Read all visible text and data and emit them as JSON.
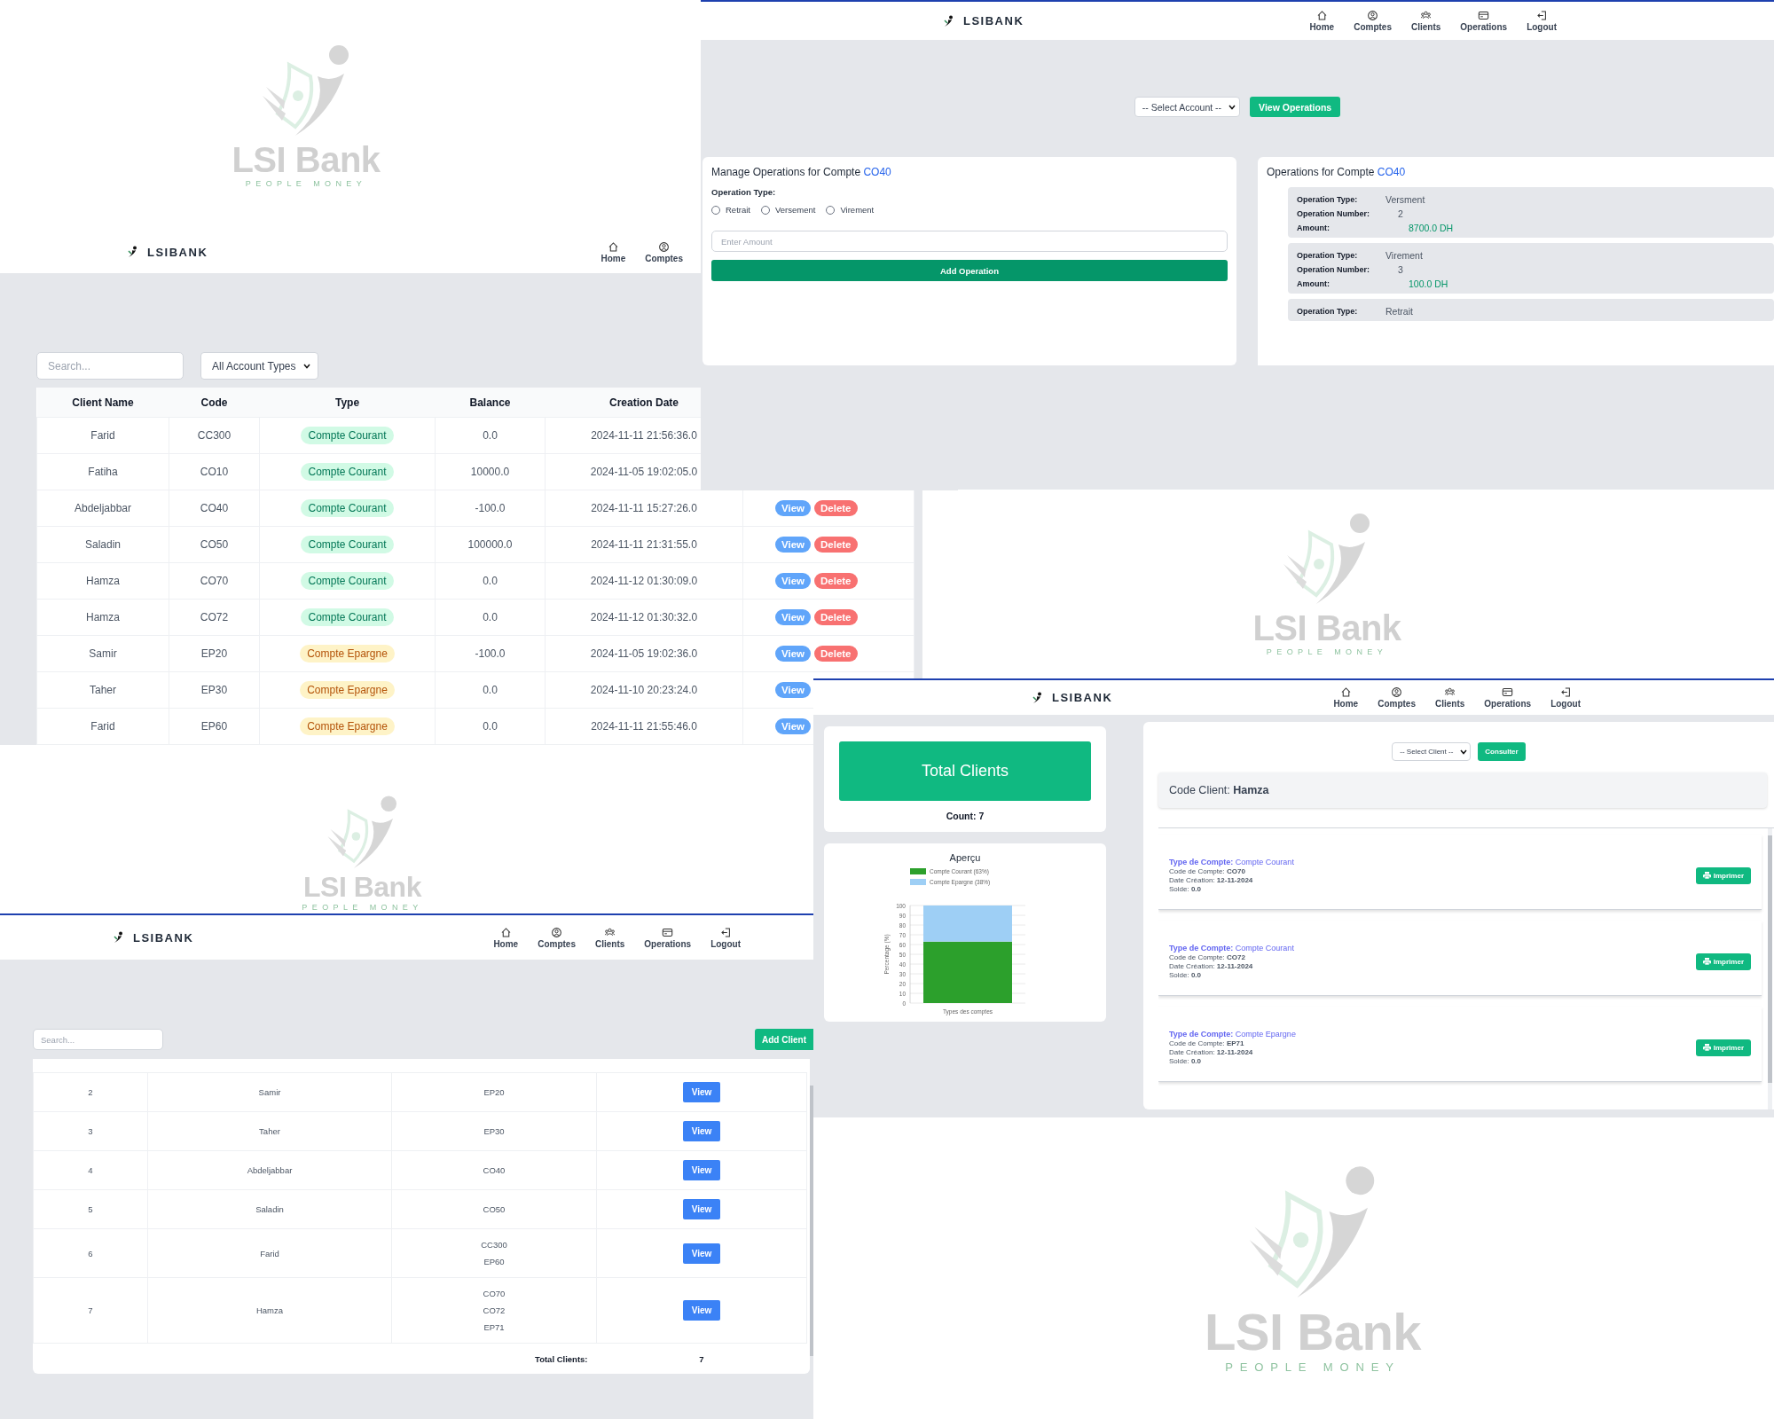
{
  "windows": [
    {
      "kind": "accounts",
      "navbar": {
        "brand": "LSIBANK",
        "items": [
          {
            "label": "Home"
          },
          {
            "label": "Comptes"
          }
        ]
      },
      "search": {
        "placeholder": "Search..."
      },
      "filter": {
        "value": "All Account Types"
      },
      "table": {
        "columns": [
          "Client Name",
          "Code",
          "Type",
          "Balance",
          "Creation Date"
        ],
        "rows": [
          {
            "client_name": "Farid",
            "code": "CC300",
            "type": {
              "label": "Compte Courant",
              "kind": "courant"
            },
            "balance": "0.0",
            "creation_date": "2024-11-11 21:56:36.0",
            "actions": []
          },
          {
            "client_name": "Fatiha",
            "code": "CO10",
            "type": {
              "label": "Compte Courant",
              "kind": "courant"
            },
            "balance": "10000.0",
            "creation_date": "2024-11-05 19:02:05.0",
            "actions": []
          },
          {
            "client_name": "Abdeljabbar",
            "code": "CO40",
            "type": {
              "label": "Compte Courant",
              "kind": "courant"
            },
            "balance": "-100.0",
            "creation_date": "2024-11-11 15:27:26.0",
            "actions": [
              {
                "kind": "view",
                "label": "View"
              },
              {
                "kind": "delete",
                "label": "Delete"
              }
            ]
          },
          {
            "client_name": "Saladin",
            "code": "CO50",
            "type": {
              "label": "Compte Courant",
              "kind": "courant"
            },
            "balance": "100000.0",
            "creation_date": "2024-11-11 21:31:55.0",
            "actions": [
              {
                "kind": "view",
                "label": "View"
              },
              {
                "kind": "delete",
                "label": "Delete"
              }
            ]
          },
          {
            "client_name": "Hamza",
            "code": "CO70",
            "type": {
              "label": "Compte Courant",
              "kind": "courant"
            },
            "balance": "0.0",
            "creation_date": "2024-11-12 01:30:09.0",
            "actions": [
              {
                "kind": "view",
                "label": "View"
              },
              {
                "kind": "delete",
                "label": "Delete"
              }
            ]
          },
          {
            "client_name": "Hamza",
            "code": "CO72",
            "type": {
              "label": "Compte Courant",
              "kind": "courant"
            },
            "balance": "0.0",
            "creation_date": "2024-11-12 01:30:32.0",
            "actions": [
              {
                "kind": "view",
                "label": "View"
              },
              {
                "kind": "delete",
                "label": "Delete"
              }
            ]
          },
          {
            "client_name": "Samir",
            "code": "EP20",
            "type": {
              "label": "Compte Epargne",
              "kind": "epargne"
            },
            "balance": "-100.0",
            "creation_date": "2024-11-05 19:02:36.0",
            "actions": [
              {
                "kind": "view",
                "label": "View"
              },
              {
                "kind": "delete",
                "label": "Delete"
              }
            ]
          },
          {
            "client_name": "Taher",
            "code": "EP30",
            "type": {
              "label": "Compte Epargne",
              "kind": "epargne"
            },
            "balance": "0.0",
            "creation_date": "2024-11-10 20:23:24.0",
            "actions": [
              {
                "kind": "view",
                "label": "View"
              }
            ]
          },
          {
            "client_name": "Farid",
            "code": "EP60",
            "type": {
              "label": "Compte Epargne",
              "kind": "epargne"
            },
            "balance": "0.0",
            "creation_date": "2024-11-11 21:55:46.0",
            "actions": [
              {
                "kind": "view",
                "label": "View"
              }
            ]
          }
        ]
      }
    },
    {
      "kind": "logo",
      "brand": "LSI Bank",
      "tagline": "PEOPLE MONEY"
    },
    {
      "kind": "operations",
      "navbar": {
        "brand": "LSIBANK",
        "items": [
          {
            "label": "Home"
          },
          {
            "label": "Comptes"
          },
          {
            "label": "Clients"
          },
          {
            "label": "Operations"
          },
          {
            "label": "Logout"
          }
        ]
      },
      "account_select": {
        "value": "-- Select Account --"
      },
      "view_button": "View Operations",
      "manage": {
        "title": "Manage Operations for Compte",
        "account": "CO40",
        "type_label": "Operation Type:",
        "options": [
          {
            "label": "Retrait",
            "selected": false
          },
          {
            "label": "Versement",
            "selected": false
          },
          {
            "label": "Virement",
            "selected": false
          }
        ],
        "amount": {
          "placeholder": "Enter Amount"
        },
        "submit": "Add Operation"
      },
      "history": {
        "title": "Operations for Compte",
        "account": "CO40",
        "items": [
          {
            "fields": [
              {
                "label": "Operation Type:",
                "value": "Versment",
                "kind": "text"
              },
              {
                "label": "Operation Number:",
                "value": "2",
                "kind": "number"
              },
              {
                "label": "Amount:",
                "value": "8700.0 DH",
                "kind": "amount"
              }
            ]
          },
          {
            "fields": [
              {
                "label": "Operation Type:",
                "value": "Virement",
                "kind": "text"
              },
              {
                "label": "Operation Number:",
                "value": "3",
                "kind": "number"
              },
              {
                "label": "Amount:",
                "value": "100.0 DH",
                "kind": "amount"
              }
            ]
          },
          {
            "fields": [
              {
                "label": "Operation Type:",
                "value": "Retrait",
                "kind": "text"
              }
            ]
          }
        ]
      }
    },
    {
      "kind": "logo",
      "brand": "LSI Bank",
      "tagline": "PEOPLE MONEY"
    },
    {
      "kind": "clients",
      "logo": {
        "brand": "LSI Bank",
        "tagline": "PEOPLE MONEY"
      },
      "navbar": {
        "brand": "LSIBANK",
        "items": [
          {
            "label": "Home"
          },
          {
            "label": "Comptes"
          },
          {
            "label": "Clients"
          },
          {
            "label": "Operations"
          },
          {
            "label": "Logout"
          }
        ]
      },
      "search": {
        "placeholder": "Search..."
      },
      "add_button": "Add Client",
      "rows": [
        {
          "number": "2",
          "name": "Samir",
          "codes": [
            "EP20"
          ],
          "action": "View"
        },
        {
          "number": "3",
          "name": "Taher",
          "codes": [
            "EP30"
          ],
          "action": "View"
        },
        {
          "number": "4",
          "name": "Abdeljabbar",
          "codes": [
            "CO40"
          ],
          "action": "View"
        },
        {
          "number": "5",
          "name": "Saladin",
          "codes": [
            "CO50"
          ],
          "action": "View"
        },
        {
          "number": "6",
          "name": "Farid",
          "codes": [
            "CC300",
            "EP60"
          ],
          "action": "View"
        },
        {
          "number": "7",
          "name": "Hamza",
          "codes": [
            "CO70",
            "CO72",
            "EP71"
          ],
          "action": "View"
        }
      ],
      "footer": {
        "label": "Total Clients:",
        "value": "7"
      }
    },
    {
      "kind": "dashboard",
      "navbar": {
        "brand": "LSIBANK",
        "items": [
          {
            "label": "Home"
          },
          {
            "label": "Comptes"
          },
          {
            "label": "Clients"
          },
          {
            "label": "Operations"
          },
          {
            "label": "Logout"
          }
        ]
      },
      "total": {
        "title": "Total Clients",
        "count": "Count: 7"
      },
      "chart": {
        "title": "Aperçu",
        "chart_data": {
          "type": "bar",
          "stacked": true,
          "grid": true,
          "legend": true,
          "xlabel": "Types des comptes",
          "ylabel": "Percentage (%)",
          "ylim": [
            0,
            100
          ],
          "yticks": [
            0,
            10,
            20,
            30,
            40,
            50,
            60,
            70,
            80,
            90,
            100
          ],
          "series": [
            {
              "name": "Compte Courant (63%)",
              "color": "#2ca02c",
              "values": [
                63
              ]
            },
            {
              "name": "Compte Epargne (38%)",
              "color": "#9ecff5",
              "values": [
                37
              ]
            }
          ]
        }
      },
      "client_select": {
        "value": "-- Select Client --"
      },
      "consult_button": "Consulter",
      "client_header": "Code Client: **Hamza**",
      "accounts": [
        {
          "type_line": "**Type de Compte:** Compte Courant",
          "code_line": "Code de Compte: **CO70**",
          "date_line": "Date Création: **12-11-2024**",
          "balance_line": "Solde: **0.0**",
          "button": "Imprimer"
        },
        {
          "type_line": "**Type de Compte:** Compte Courant",
          "code_line": "Code de Compte: **CO72**",
          "date_line": "Date Création: **12-11-2024**",
          "balance_line": "Solde: **0.0**",
          "button": "Imprimer"
        },
        {
          "type_line": "**Type de Compte:** Compte Epargne",
          "code_line": "Code de Compte: **EP71**",
          "date_line": "Date Création: **12-11-2024**",
          "balance_line": "Solde: **0.0**",
          "button": "Imprimer"
        }
      ]
    },
    {
      "kind": "logo",
      "brand": "LSI Bank",
      "tagline": "PEOPLE MONEY"
    }
  ]
}
